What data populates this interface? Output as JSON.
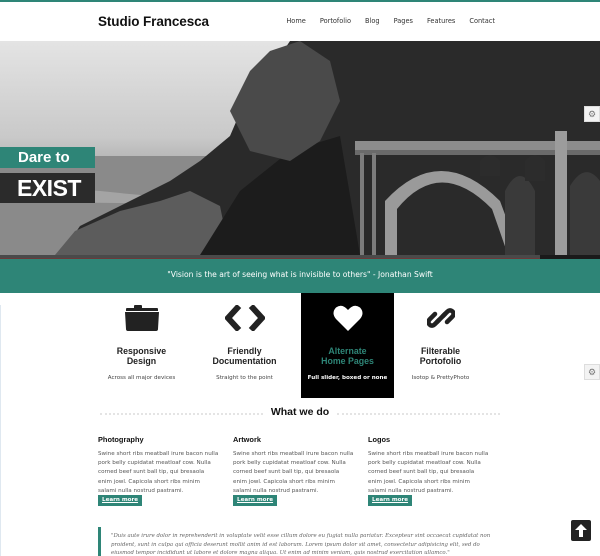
{
  "brand": {
    "title": "Studio Francesca",
    "accent": "#2e8577"
  },
  "nav": {
    "items": [
      {
        "label": "Home"
      },
      {
        "label": "Portofolio"
      },
      {
        "label": "Blog"
      },
      {
        "label": "Pages"
      },
      {
        "label": "Features"
      },
      {
        "label": "Contact"
      }
    ]
  },
  "hero": {
    "line1": "Dare to",
    "line2": "EXIST",
    "image": "black-and-white coastal cliff with arched bridge",
    "slider_progress_percent": 90,
    "settings_icon": "gear-icon"
  },
  "quote_band": {
    "text": "\"Vision is the art of seeing what is invisible to others\" - Jonathan Swift"
  },
  "features": [
    {
      "icon": "folder-icon",
      "title_line1": "Responsive",
      "title_line2": "Design",
      "subtitle": "Across all major devices",
      "active": false
    },
    {
      "icon": "code-icon",
      "title_line1": "Friendly",
      "title_line2": "Documentation",
      "subtitle": "Straight to the point",
      "active": false
    },
    {
      "icon": "heart-icon",
      "title_line1": "Alternate",
      "title_line2": "Home Pages",
      "subtitle": "Full slider, boxed or none",
      "active": true
    },
    {
      "icon": "link-icon",
      "title_line1": "Filterable",
      "title_line2": "Portofolio",
      "subtitle": "Isotop & PrettyPhoto",
      "active": false
    }
  ],
  "what_we_do": {
    "heading": "What we do",
    "columns": [
      {
        "title": "Photography",
        "body": "Swine short ribs meatball irure bacon nulla pork belly cupidatat meatloaf cow. Nulla corned beef sunt ball tip, qui bresaola enim jowl. Capicola short ribs minim salami nulla nostrud pastrami.",
        "button": "Learn more"
      },
      {
        "title": "Artwork",
        "body": "Swine short ribs meatball irure bacon nulla pork belly cupidatat meatloaf cow. Nulla corned beef sunt ball tip, qui bresaola enim jowl. Capicola short ribs minim salami nulla nostrud pastrami.",
        "button": "Learn more"
      },
      {
        "title": "Logos",
        "body": "Swine short ribs meatball irure bacon nulla pork belly cupidatat meatloaf cow. Nulla corned beef sunt ball tip, qui bresaola enim jowl. Capicola short ribs minim salami nulla nostrud pastrami.",
        "button": "Learn more"
      }
    ]
  },
  "testimonial": {
    "text": "\"Duis aute irure dolor in reprehenderit in voluptate velit esse cillum dolore eu fugiat nulla pariatur. Excepteur sint occaecat cupidatat non proident, sunt in culpa qui officia deserunt mollit anim id est laborum. Lorem ipsum dolor sit amet, consectetur adipisicing elit, sed do eiusmod tempor incididunt ut labore et dolore magna aliqua. Ut enim ad minim veniam, quis nostrud exercitation ullamco.\""
  },
  "back_to_top": {
    "icon": "arrow-up-icon"
  }
}
